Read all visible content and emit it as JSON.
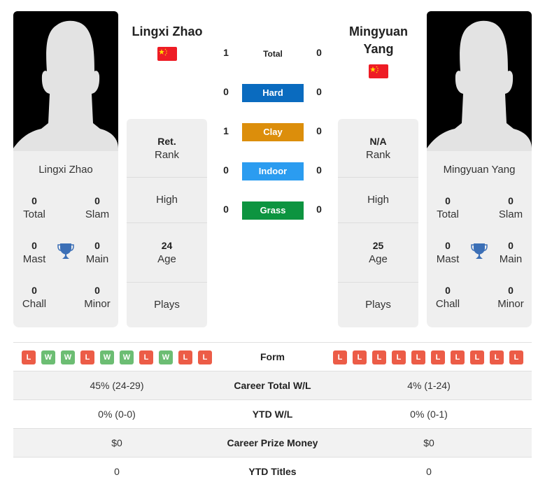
{
  "players": {
    "left": {
      "name": "Lingxi Zhao",
      "card_name": "Lingxi Zhao",
      "country_flag": "china-flag",
      "titles": {
        "total": "0",
        "slam": "0",
        "mast": "0",
        "main": "0",
        "chall": "0",
        "minor": "0"
      },
      "info": {
        "rank_value": "Ret.",
        "rank_label": "Rank",
        "high_label": "High",
        "age_value": "24",
        "age_label": "Age",
        "plays_label": "Plays"
      },
      "form": [
        "L",
        "W",
        "W",
        "L",
        "W",
        "W",
        "L",
        "W",
        "L",
        "L"
      ],
      "career_total_wl": "45% (24-29)",
      "ytd_wl": "0% (0-0)",
      "career_prize_money": "$0",
      "ytd_titles": "0"
    },
    "right": {
      "name": "Mingyuan Yang",
      "name_line1": "Mingyuan",
      "name_line2": "Yang",
      "card_name": "Mingyuan Yang",
      "country_flag": "china-flag",
      "titles": {
        "total": "0",
        "slam": "0",
        "mast": "0",
        "main": "0",
        "chall": "0",
        "minor": "0"
      },
      "info": {
        "rank_value": "N/A",
        "rank_label": "Rank",
        "high_label": "High",
        "age_value": "25",
        "age_label": "Age",
        "plays_label": "Plays"
      },
      "form": [
        "L",
        "L",
        "L",
        "L",
        "L",
        "L",
        "L",
        "L",
        "L",
        "L"
      ],
      "career_total_wl": "4% (1-24)",
      "ytd_wl": "0% (0-1)",
      "career_prize_money": "$0",
      "ytd_titles": "0"
    }
  },
  "title_labels": {
    "total": "Total",
    "slam": "Slam",
    "mast": "Mast",
    "main": "Main",
    "chall": "Chall",
    "minor": "Minor"
  },
  "h2h": [
    {
      "label": "Total",
      "left": "1",
      "right": "0",
      "color": ""
    },
    {
      "label": "Hard",
      "left": "0",
      "right": "0",
      "color": "#0a6bbf"
    },
    {
      "label": "Clay",
      "left": "1",
      "right": "0",
      "color": "#dc8e0b"
    },
    {
      "label": "Indoor",
      "left": "0",
      "right": "0",
      "color": "#2b9cf0"
    },
    {
      "label": "Grass",
      "left": "0",
      "right": "0",
      "color": "#0d9440"
    }
  ],
  "comparison_labels": {
    "form": "Form",
    "career_total_wl": "Career Total W/L",
    "ytd_wl": "YTD W/L",
    "career_prize_money": "Career Prize Money",
    "ytd_titles": "YTD Titles"
  },
  "colors": {
    "loss": "#ec5c47",
    "win": "#6cbd73",
    "trophy": "#3b6fb6",
    "card_bg": "#efefef"
  }
}
